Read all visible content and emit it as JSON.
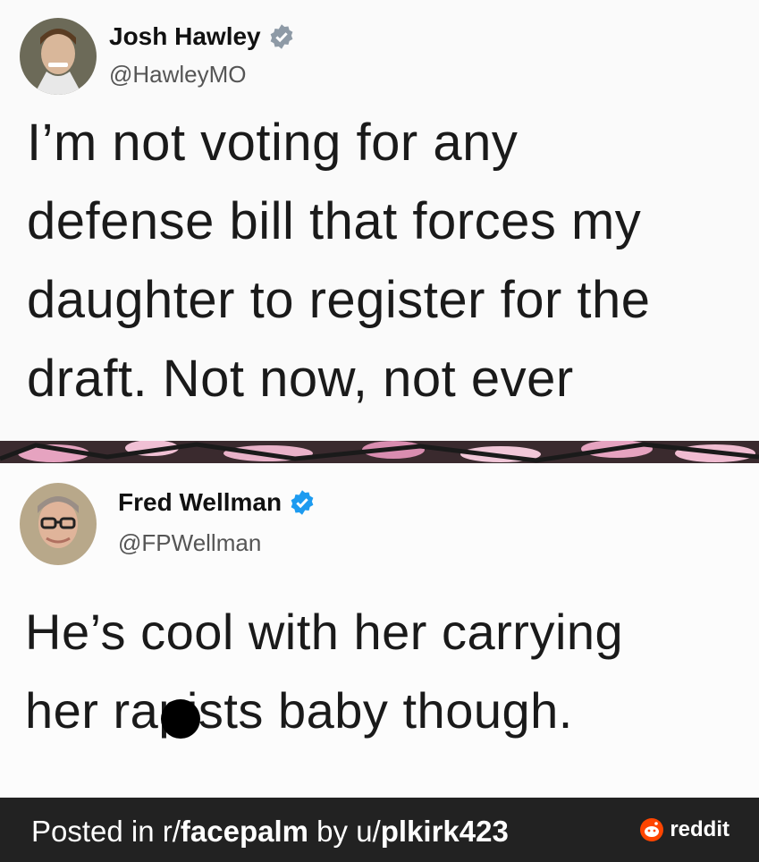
{
  "tweet1": {
    "name": "Josh Hawley",
    "handle": "@HawleyMO",
    "lines": [
      "I’m not voting for any",
      "defense bill that forces my",
      "daughter to register for the",
      "draft. Not now, not ever"
    ]
  },
  "tweet2": {
    "name": "Fred Wellman",
    "handle": "@FPWellman",
    "lines": [
      "He’s cool with her carrying",
      "her rapists baby though."
    ]
  },
  "footer": {
    "prefix": "Posted in r/",
    "subreddit": "facepalm",
    "by": " by u/",
    "user": "plkirk423",
    "brand": "reddit"
  },
  "colors": {
    "badge_gray": "#8e9aa6",
    "badge_blue": "#1d9bf0",
    "footer_bg": "#222222",
    "reddit_orange": "#ff4500"
  }
}
